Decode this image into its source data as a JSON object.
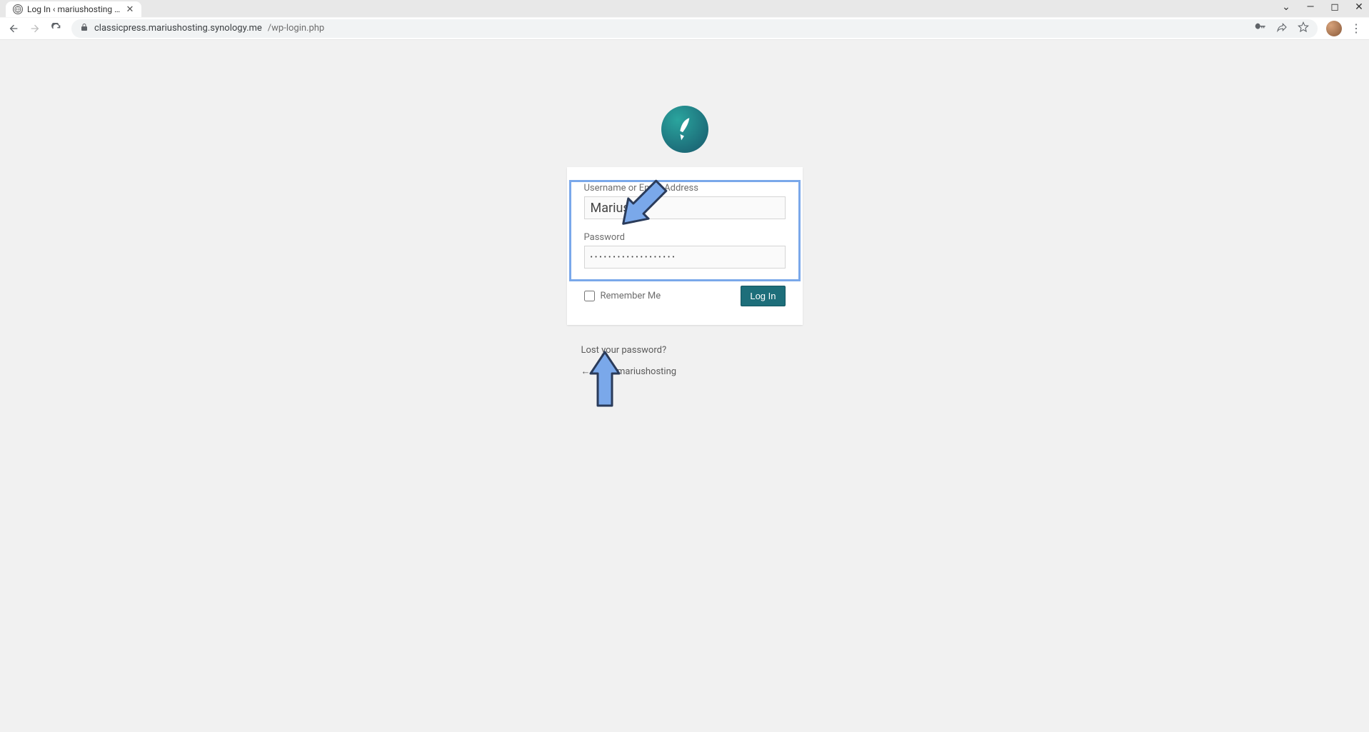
{
  "browser": {
    "tab_title": "Log In ‹ mariushosting — Classic",
    "url_host": "classicpress.mariushosting.synology.me",
    "url_path": "/wp-login.php"
  },
  "login": {
    "username_label": "Username or Email Address",
    "username_value": "Marius",
    "password_label": "Password",
    "password_value": "•••••••••••••••••••",
    "remember_label": "Remember Me",
    "submit_label": "Log In",
    "lost_password_link": "Lost your password?",
    "back_link": "← Go to mariushosting"
  }
}
